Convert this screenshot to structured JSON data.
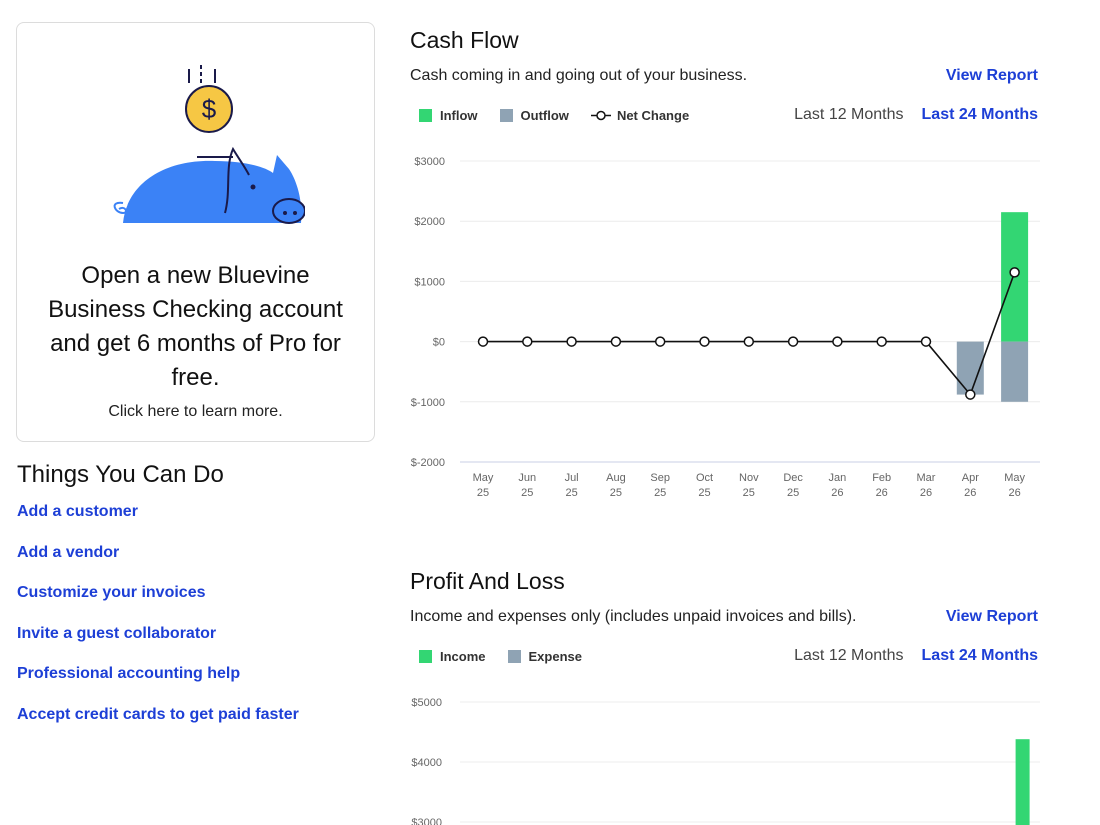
{
  "promo": {
    "title": "Open a new Bluevine Business Checking account and get 6 months of Pro for free.",
    "link": "Click here to learn more.",
    "coin_symbol": "$"
  },
  "todo": {
    "title": "Things You Can Do",
    "items": [
      "Add a customer",
      "Add a vendor",
      "Customize your invoices",
      "Invite a guest collaborator",
      "Professional accounting help",
      "Accept credit cards to get paid faster"
    ]
  },
  "cash_flow": {
    "title": "Cash Flow",
    "subtitle": "Cash coming in and going out of your business.",
    "view_report": "View Report",
    "legend": {
      "inflow": "Inflow",
      "outflow": "Outflow",
      "net": "Net Change"
    },
    "range_12": "Last 12 Months",
    "range_24": "Last 24 Months"
  },
  "profit_loss": {
    "title": "Profit And Loss",
    "subtitle": "Income and expenses only (includes unpaid invoices and bills).",
    "view_report": "View Report",
    "legend": {
      "income": "Income",
      "expense": "Expense"
    },
    "range_12": "Last 12 Months",
    "range_24": "Last 24 Months"
  },
  "colors": {
    "inflow": "#33d673",
    "outflow": "#8fa3b4",
    "net_line": "#111111",
    "link": "#1d3fd6",
    "promo_blue": "#3b82f6",
    "coin": "#f6c744"
  },
  "chart_data": [
    {
      "type": "bar",
      "title": "Cash Flow",
      "categories": [
        [
          "May",
          "25"
        ],
        [
          "Jun",
          "25"
        ],
        [
          "Jul",
          "25"
        ],
        [
          "Aug",
          "25"
        ],
        [
          "Sep",
          "25"
        ],
        [
          "Oct",
          "25"
        ],
        [
          "Nov",
          "25"
        ],
        [
          "Dec",
          "25"
        ],
        [
          "Jan",
          "26"
        ],
        [
          "Feb",
          "26"
        ],
        [
          "Mar",
          "26"
        ],
        [
          "Apr",
          "26"
        ],
        [
          "May",
          "26"
        ]
      ],
      "series": [
        {
          "name": "Inflow",
          "values": [
            0,
            0,
            0,
            0,
            0,
            0,
            0,
            0,
            0,
            0,
            0,
            0,
            2150
          ]
        },
        {
          "name": "Outflow",
          "values": [
            0,
            0,
            0,
            0,
            0,
            0,
            0,
            0,
            0,
            0,
            0,
            -880,
            -1000
          ]
        },
        {
          "name": "Net Change",
          "values": [
            0,
            0,
            0,
            0,
            0,
            0,
            0,
            0,
            0,
            0,
            0,
            -880,
            1150
          ]
        }
      ],
      "yticks": [
        "$3000",
        "$2000",
        "$1000",
        "$0",
        "$-1000",
        "$-2000"
      ],
      "ylim": [
        -2000,
        3000
      ],
      "grid": true
    },
    {
      "type": "bar",
      "title": "Profit And Loss",
      "series": [
        {
          "name": "Income",
          "values": [
            0,
            0,
            0,
            0,
            0,
            0,
            0,
            0,
            0,
            0,
            0,
            0,
            4380
          ]
        },
        {
          "name": "Expense",
          "values": [
            0,
            0,
            0,
            0,
            0,
            0,
            0,
            0,
            0,
            0,
            0,
            0,
            0
          ]
        }
      ],
      "yticks_visible": [
        "$5000",
        "$4000",
        "$3000"
      ],
      "grid": true
    }
  ]
}
